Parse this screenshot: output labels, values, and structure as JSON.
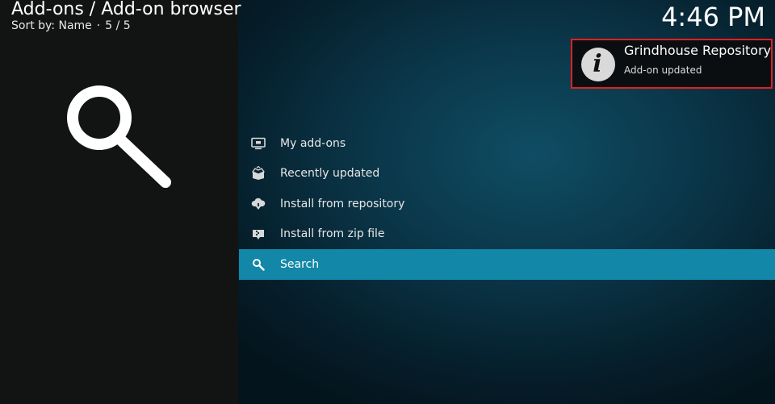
{
  "header": {
    "breadcrumb": "Add-ons / Add-on browser",
    "sort_label": "Sort by: Name",
    "separator": "·",
    "position": "5 / 5"
  },
  "clock": "4:46 PM",
  "side_panel": {
    "icon": "search-icon"
  },
  "menu": {
    "items": [
      {
        "label": "My add-ons",
        "icon": "monitor-icon",
        "selected": false
      },
      {
        "label": "Recently updated",
        "icon": "box-open-icon",
        "selected": false
      },
      {
        "label": "Install from repository",
        "icon": "cloud-download-icon",
        "selected": false
      },
      {
        "label": "Install from zip file",
        "icon": "zip-box-icon",
        "selected": false
      },
      {
        "label": "Search",
        "icon": "search-icon",
        "selected": true
      }
    ]
  },
  "notification": {
    "title": "Grindhouse Repository",
    "message": "Add-on updated",
    "icon": "info-icon",
    "glyph": "i"
  },
  "colors": {
    "selected_bg": "#1287a8",
    "left_panel_bg": "#121414",
    "toast_border": "#e02020"
  }
}
